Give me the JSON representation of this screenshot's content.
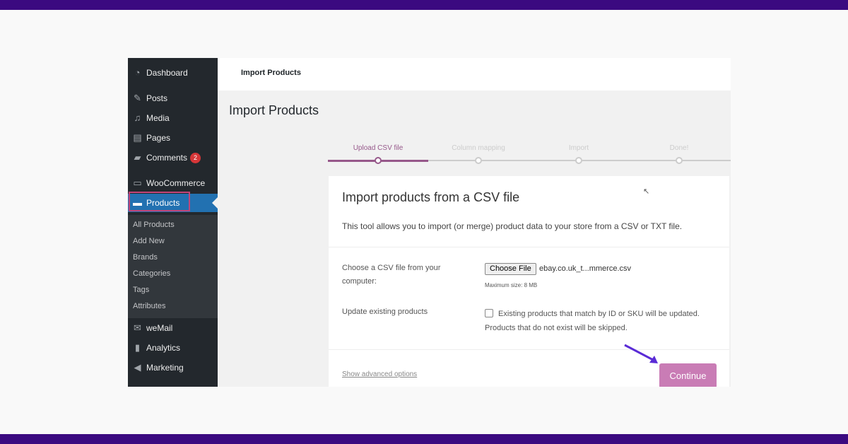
{
  "colors": {
    "frame": "#3b0a80",
    "sidebar": "#23282d",
    "active": "#2271b1",
    "accent": "#96588a",
    "button": "#c97cb5"
  },
  "sidebar": {
    "items": [
      {
        "label": "Dashboard",
        "icon": "dashboard-icon"
      },
      {
        "label": "Posts",
        "icon": "pin-icon"
      },
      {
        "label": "Media",
        "icon": "media-icon"
      },
      {
        "label": "Pages",
        "icon": "pages-icon"
      },
      {
        "label": "Comments",
        "icon": "comment-icon",
        "badge": "2"
      },
      {
        "label": "WooCommerce",
        "icon": "woo-icon"
      },
      {
        "label": "Products",
        "icon": "archive-icon",
        "active": true
      },
      {
        "label": "weMail",
        "icon": "mail-icon"
      },
      {
        "label": "Analytics",
        "icon": "bar-chart-icon"
      },
      {
        "label": "Marketing",
        "icon": "megaphone-icon"
      }
    ],
    "submenu": [
      "All Products",
      "Add New",
      "Brands",
      "Categories",
      "Tags",
      "Attributes"
    ]
  },
  "header": {
    "title": "Import Products"
  },
  "page_title": "Import Products",
  "steps": [
    "Upload CSV file",
    "Column mapping",
    "Import",
    "Done!"
  ],
  "card": {
    "title": "Import products from a CSV file",
    "description": "This tool allows you to import (or merge) product data to your store from a CSV or TXT file.",
    "file_label": "Choose a CSV file from your computer:",
    "choose_button": "Choose File",
    "file_name": "ebay.co.uk_t...mmerce.csv",
    "max_size": "Maximum size: 8 MB",
    "update_label": "Update existing products",
    "update_text": "Existing products that match by ID or SKU will be updated. Products that do not exist will be skipped.",
    "update_checked": false,
    "advanced": "Show advanced options",
    "continue": "Continue"
  }
}
